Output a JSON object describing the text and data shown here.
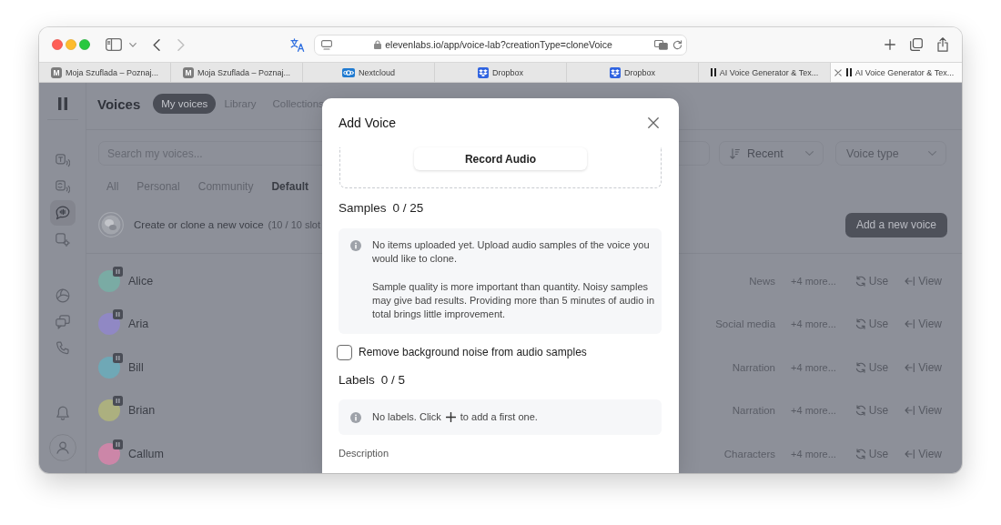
{
  "browser": {
    "navigation": [
      {
        "kind": "back",
        "disabled": false
      },
      {
        "kind": "forward",
        "disabled": true
      }
    ],
    "url": "elevenlabs.io/app/voice-lab?creationType=cloneVoice",
    "tabs": [
      {
        "title": "Moja Szuflada – Poznaj...",
        "kind": "letter",
        "favicon_letter": "M",
        "selected": false
      },
      {
        "title": "Moja Szuflada – Poznaj...",
        "kind": "letter",
        "favicon_letter": "M",
        "selected": false
      },
      {
        "title": "Nextcloud",
        "kind": "rings",
        "selected": false
      },
      {
        "title": "Dropbox",
        "kind": "box",
        "selected": false
      },
      {
        "title": "Dropbox",
        "kind": "box",
        "selected": false
      },
      {
        "title": "AI Voice Generator & Tex...",
        "kind": "bars",
        "selected": false
      },
      {
        "title": "AI Voice Generator & Tex...",
        "kind": "bars",
        "selected": true
      }
    ]
  },
  "sidebar": {
    "primary": [
      {
        "selected": false
      },
      {
        "selected": false
      },
      {
        "selected": true
      },
      {
        "selected": false
      }
    ],
    "secondary": [
      {
        "selected": false
      },
      {
        "selected": false
      },
      {
        "selected": false
      }
    ]
  },
  "header": {
    "title": "Voices",
    "tabs": [
      {
        "label": "My voices",
        "selected": true
      },
      {
        "label": "Library",
        "selected": false
      },
      {
        "label": "Collections",
        "selected": false
      }
    ]
  },
  "search": {
    "placeholder": "Search my voices..."
  },
  "filters": [
    {
      "kind": "sort",
      "label": "Recent"
    },
    {
      "kind": "plain",
      "label": "Voice type"
    }
  ],
  "categories": [
    {
      "label": "All",
      "selected": false
    },
    {
      "label": "Personal",
      "selected": false
    },
    {
      "label": "Community",
      "selected": false
    },
    {
      "label": "Default",
      "selected": true
    }
  ],
  "create": {
    "label": "Create or clone a new voice",
    "slots": "(10 / 10 slot",
    "button": "Add a new voice"
  },
  "voices": [
    {
      "name": "Alice",
      "color": "#7aaba4",
      "tag": "News",
      "more": "+4 more...",
      "use": "Use",
      "view": "View"
    },
    {
      "name": "Aria",
      "color": "#9088c4",
      "tag": "Social media",
      "more": "+4 more...",
      "use": "Use",
      "view": "View"
    },
    {
      "name": "Bill",
      "color": "#6fa8b6",
      "tag": "Narration",
      "more": "+4 more...",
      "use": "Use",
      "view": "View"
    },
    {
      "name": "Brian",
      "color": "#acb07f",
      "tag": "Narration",
      "more": "+4 more...",
      "use": "Use",
      "view": "View"
    },
    {
      "name": "Callum",
      "color": "#cc86a8",
      "tag": "Characters",
      "more": "+4 more...",
      "use": "Use",
      "view": "View"
    }
  ],
  "modal": {
    "title": "Add Voice",
    "record_button": "Record Audio",
    "samples": {
      "title": "Samples",
      "count": "0 / 25",
      "paragraphs": [
        "No items uploaded yet. Upload audio samples of the voice you would like to clone.",
        "Sample quality is more important than quantity. Noisy samples may give bad results. Providing more than 5 minutes of audio in total brings little improvement."
      ]
    },
    "noise_checkbox": {
      "label": "Remove background noise from audio samples",
      "checked": false
    },
    "labels": {
      "title": "Labels",
      "count": "0 / 5",
      "text_before": "No labels. Click",
      "text_after": "to add a first one."
    },
    "description_label": "Description"
  }
}
